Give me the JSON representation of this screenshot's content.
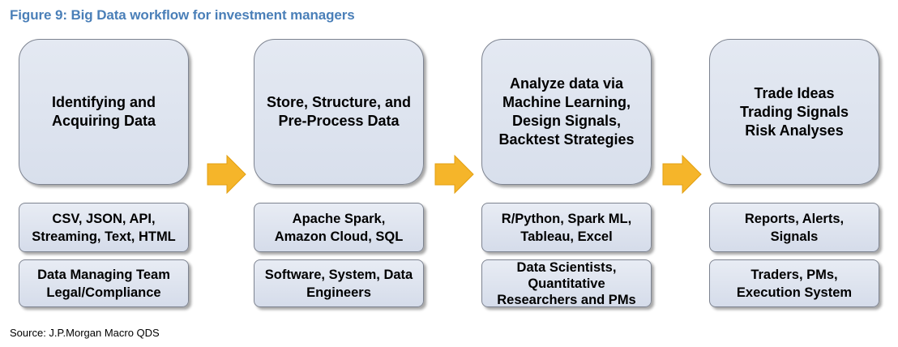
{
  "figure_title": "Figure 9: Big Data workflow for investment managers",
  "source": "Source: J.P.Morgan Macro QDS",
  "stages": [
    {
      "main": "Identifying and\nAcquiring Data",
      "tools": "CSV, JSON, API,\nStreaming, Text, HTML",
      "people": "Data Managing Team\nLegal/Compliance"
    },
    {
      "main": "Store, Structure, and\nPre-Process Data",
      "tools": "Apache Spark,\nAmazon Cloud, SQL",
      "people": "Software, System, Data\nEngineers"
    },
    {
      "main": "Analyze data via\nMachine Learning,\nDesign Signals,\nBacktest Strategies",
      "tools": "R/Python, Spark ML,\nTableau, Excel",
      "people": "Data Scientists,\nQuantitative\nResearchers and PMs"
    },
    {
      "main": "Trade Ideas\nTrading Signals\nRisk Analyses",
      "tools": "Reports, Alerts,\nSignals",
      "people": "Traders, PMs,\nExecution System"
    }
  ],
  "colors": {
    "title": "#4a7fb8",
    "box_fill": "#dde3ee",
    "box_border": "#7d8390",
    "arrow": "#f5b52a"
  }
}
